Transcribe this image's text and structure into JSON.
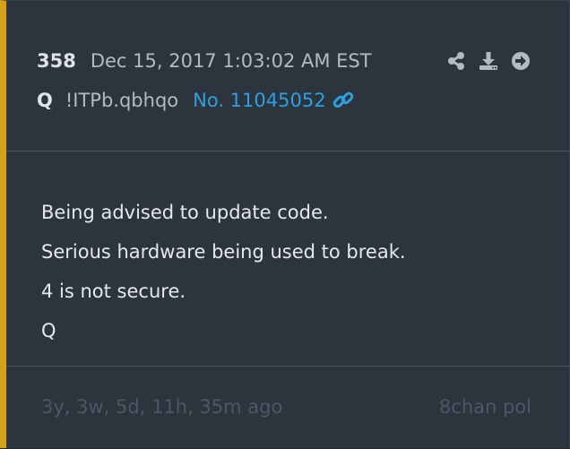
{
  "post": {
    "number": "358",
    "date": "Dec 15, 2017 1:03:02 AM EST",
    "poster_name": "Q",
    "tripcode": "!ITPb.qbhqo",
    "post_link": "No. 11045052",
    "actions": [
      "share-icon",
      "download-icon",
      "arrow-right-circle-icon"
    ]
  },
  "message": {
    "lines": [
      "Being advised to update code.",
      "Serious hardware being used to break.",
      "4 is not secure.",
      "Q"
    ]
  },
  "footer": {
    "time_ago": "3y, 3w, 5d, 11h, 35m ago",
    "source": "8chan pol"
  },
  "colors": {
    "accent_bar": "#d4a21a",
    "link": "#2f9fe0",
    "background": "#2c343d"
  }
}
